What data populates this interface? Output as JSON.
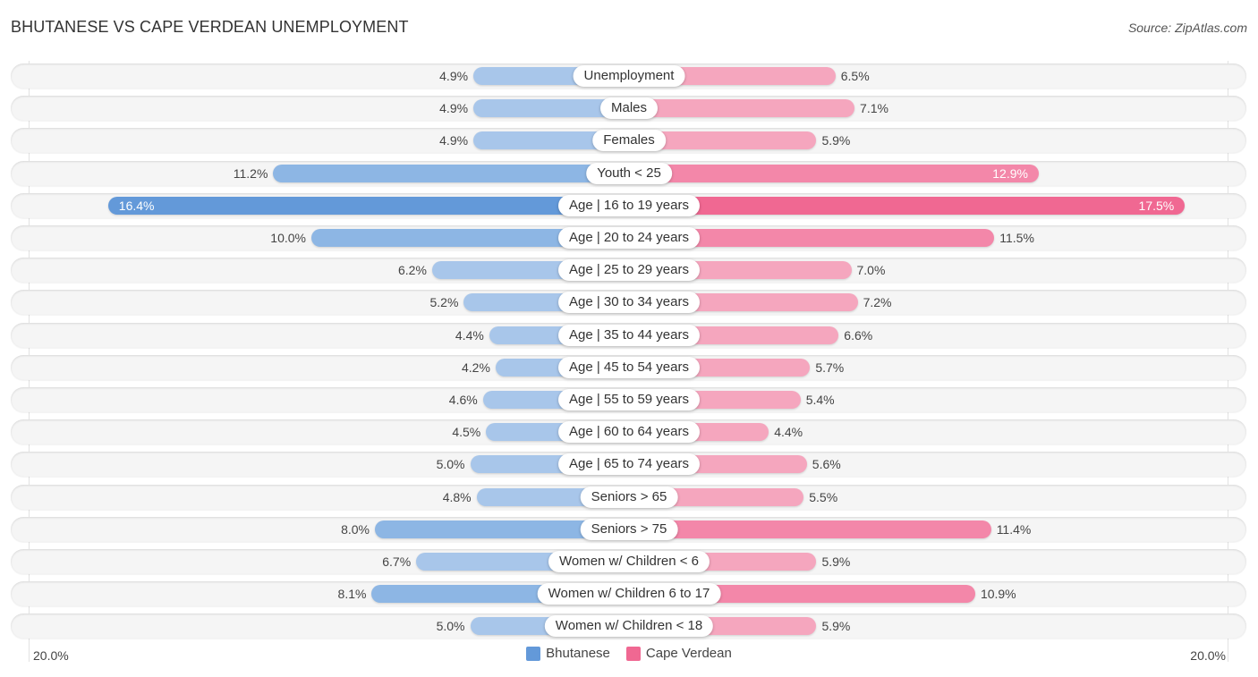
{
  "title": "BHUTANESE VS CAPE VERDEAN UNEMPLOYMENT",
  "source": "Source: ZipAtlas.com",
  "colors": {
    "bhutanese_light": "#a8c6ea",
    "bhutanese_strong": "#6399d9",
    "cape_verdean_light": "#f5a6be",
    "cape_verdean_strong": "#f06892"
  },
  "legend": {
    "left_label": "Bhutanese",
    "right_label": "Cape Verdean",
    "left_color": "#6399d9",
    "right_color": "#f06892"
  },
  "axis": {
    "left_max_label": "20.0%",
    "right_max_label": "20.0%"
  },
  "chart_data": {
    "type": "bar",
    "orientation": "horizontal-diverging",
    "title": "BHUTANESE VS CAPE VERDEAN UNEMPLOYMENT",
    "xlabel": "",
    "ylabel": "",
    "xlim": [
      -20,
      20
    ],
    "grid": false,
    "legend_position": "bottom-center",
    "categories": [
      "Unemployment",
      "Males",
      "Females",
      "Youth < 25",
      "Age | 16 to 19 years",
      "Age | 20 to 24 years",
      "Age | 25 to 29 years",
      "Age | 30 to 34 years",
      "Age | 35 to 44 years",
      "Age | 45 to 54 years",
      "Age | 55 to 59 years",
      "Age | 60 to 64 years",
      "Age | 65 to 74 years",
      "Seniors > 65",
      "Seniors > 75",
      "Women w/ Children < 6",
      "Women w/ Children 6 to 17",
      "Women w/ Children < 18"
    ],
    "series": [
      {
        "name": "Bhutanese",
        "side": "left",
        "values": [
          4.9,
          4.9,
          4.9,
          11.2,
          16.4,
          10.0,
          6.2,
          5.2,
          4.4,
          4.2,
          4.6,
          4.5,
          5.0,
          4.8,
          8.0,
          6.7,
          8.1,
          5.0
        ],
        "labels": [
          "4.9%",
          "4.9%",
          "4.9%",
          "11.2%",
          "16.4%",
          "10.0%",
          "6.2%",
          "5.2%",
          "4.4%",
          "4.2%",
          "4.6%",
          "4.5%",
          "5.0%",
          "4.8%",
          "8.0%",
          "6.7%",
          "8.1%",
          "5.0%"
        ]
      },
      {
        "name": "Cape Verdean",
        "side": "right",
        "values": [
          6.5,
          7.1,
          5.9,
          12.9,
          17.5,
          11.5,
          7.0,
          7.2,
          6.6,
          5.7,
          5.4,
          4.4,
          5.6,
          5.5,
          11.4,
          5.9,
          10.9,
          5.9
        ],
        "labels": [
          "6.5%",
          "7.1%",
          "5.9%",
          "12.9%",
          "17.5%",
          "11.5%",
          "7.0%",
          "7.2%",
          "6.6%",
          "5.7%",
          "5.4%",
          "4.4%",
          "5.6%",
          "5.5%",
          "11.4%",
          "5.9%",
          "10.9%",
          "5.9%"
        ]
      }
    ]
  }
}
